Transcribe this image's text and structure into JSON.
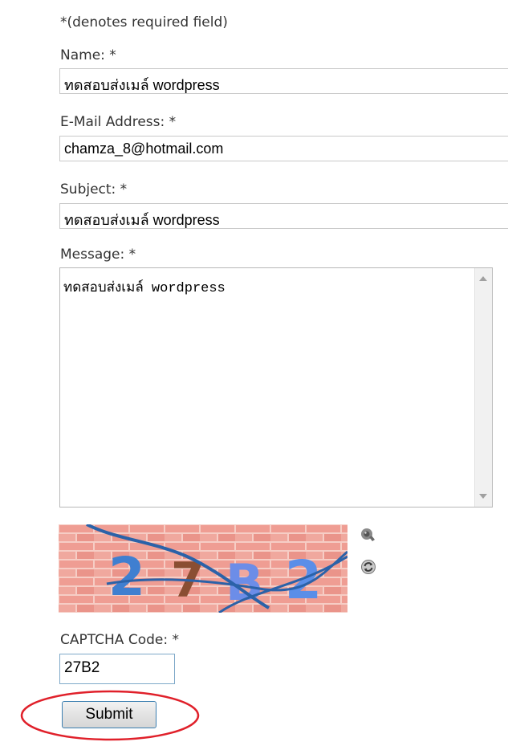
{
  "form": {
    "required_note": "*(denotes required field)",
    "name_label": "Name: *",
    "name_value": "ทดสอบส่งเมล์ wordpress",
    "email_label": "E-Mail Address: *",
    "email_value": "chamza_8@hotmail.com",
    "subject_label": "Subject: *",
    "subject_value": "ทดสอบส่งเมล์ wordpress",
    "message_label": "Message: *",
    "message_value": "ทดสอบส่งเมล์ wordpress",
    "captcha_image_text": "27B2",
    "captcha_label": "CAPTCHA Code: *",
    "captcha_value": "27B2",
    "submit_label": "Submit"
  },
  "icons": {
    "audio": "speaker-icon",
    "refresh": "refresh-icon"
  },
  "colors": {
    "highlight_ring": "#e0202a",
    "submit_border": "#3c7fb1",
    "captcha_input_border": "#7fa9c9"
  }
}
